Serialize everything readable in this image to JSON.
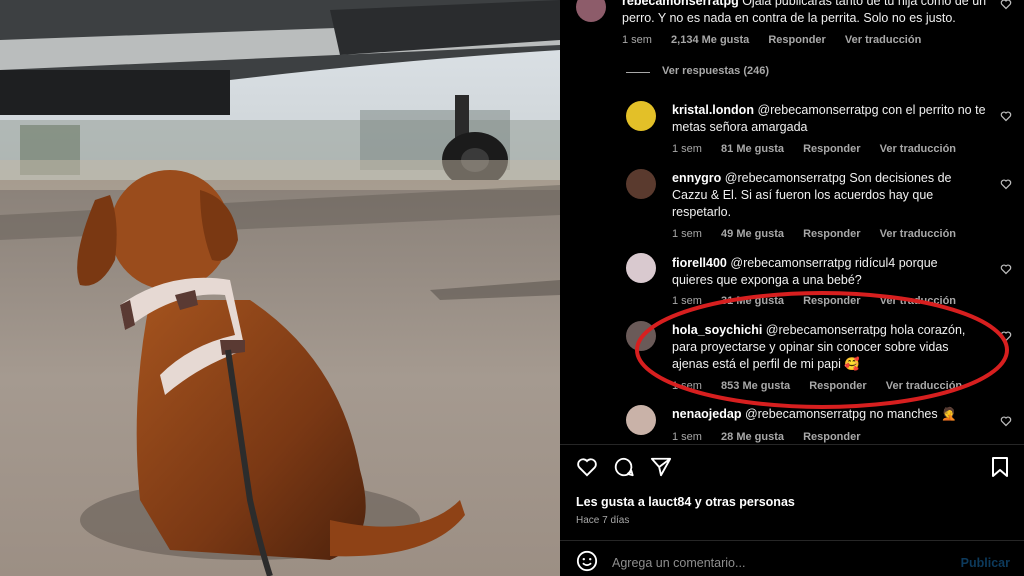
{
  "post": {
    "top_comment": {
      "username": "rebecamonserratpg",
      "text": "Ojalá publicaras tanto de tu hija como de un perro. Y no es nada en contra de la perrita. Solo no es justo.",
      "time": "1 sem",
      "likes": "2,134 Me gusta",
      "reply": "Responder",
      "translate": "Ver traducción",
      "view_replies": "Ver respuestas (246)"
    },
    "replies": [
      {
        "username": "kristal.london",
        "text": "@rebecamonserratpg con el perrito no te metas señora amargada",
        "time": "1 sem",
        "likes": "81 Me gusta",
        "reply": "Responder",
        "translate": "Ver traducción"
      },
      {
        "username": "ennygro",
        "text": "@rebecamonserratpg Son decisiones de Cazzu & El. Si así fueron los acuerdos hay que respetarlo.",
        "time": "1 sem",
        "likes": "49 Me gusta",
        "reply": "Responder",
        "translate": "Ver traducción"
      },
      {
        "username": "fiorell400",
        "text": "@rebecamonserratpg ridícul4 porque quieres que exponga a una bebé?",
        "time": "1 sem",
        "likes": "31 Me gusta",
        "reply": "Responder",
        "translate": "Ver traducción"
      },
      {
        "username": "hola_soychichi",
        "text": "@rebecamonserratpg hola corazón, para proyectarse y opinar sin conocer sobre vidas ajenas está el perfil de mi papi 🥰",
        "time": "1 sem",
        "likes": "853 Me gusta",
        "reply": "Responder",
        "translate": "Ver traducción"
      },
      {
        "username": "nenaojedap",
        "text": "@rebecamonserratpg no manches 🤦",
        "time": "1 sem",
        "likes": "28 Me gusta",
        "reply": "Responder",
        "translate": ""
      }
    ],
    "likes_summary": "Les gusta a lauct84 y otras personas",
    "posted_ago": "Hace 7 días",
    "add_comment_placeholder": "Agrega un comentario...",
    "publish_label": "Publicar"
  },
  "colors": {
    "highlight_circle": "#d71f1f",
    "background": "#000000"
  }
}
